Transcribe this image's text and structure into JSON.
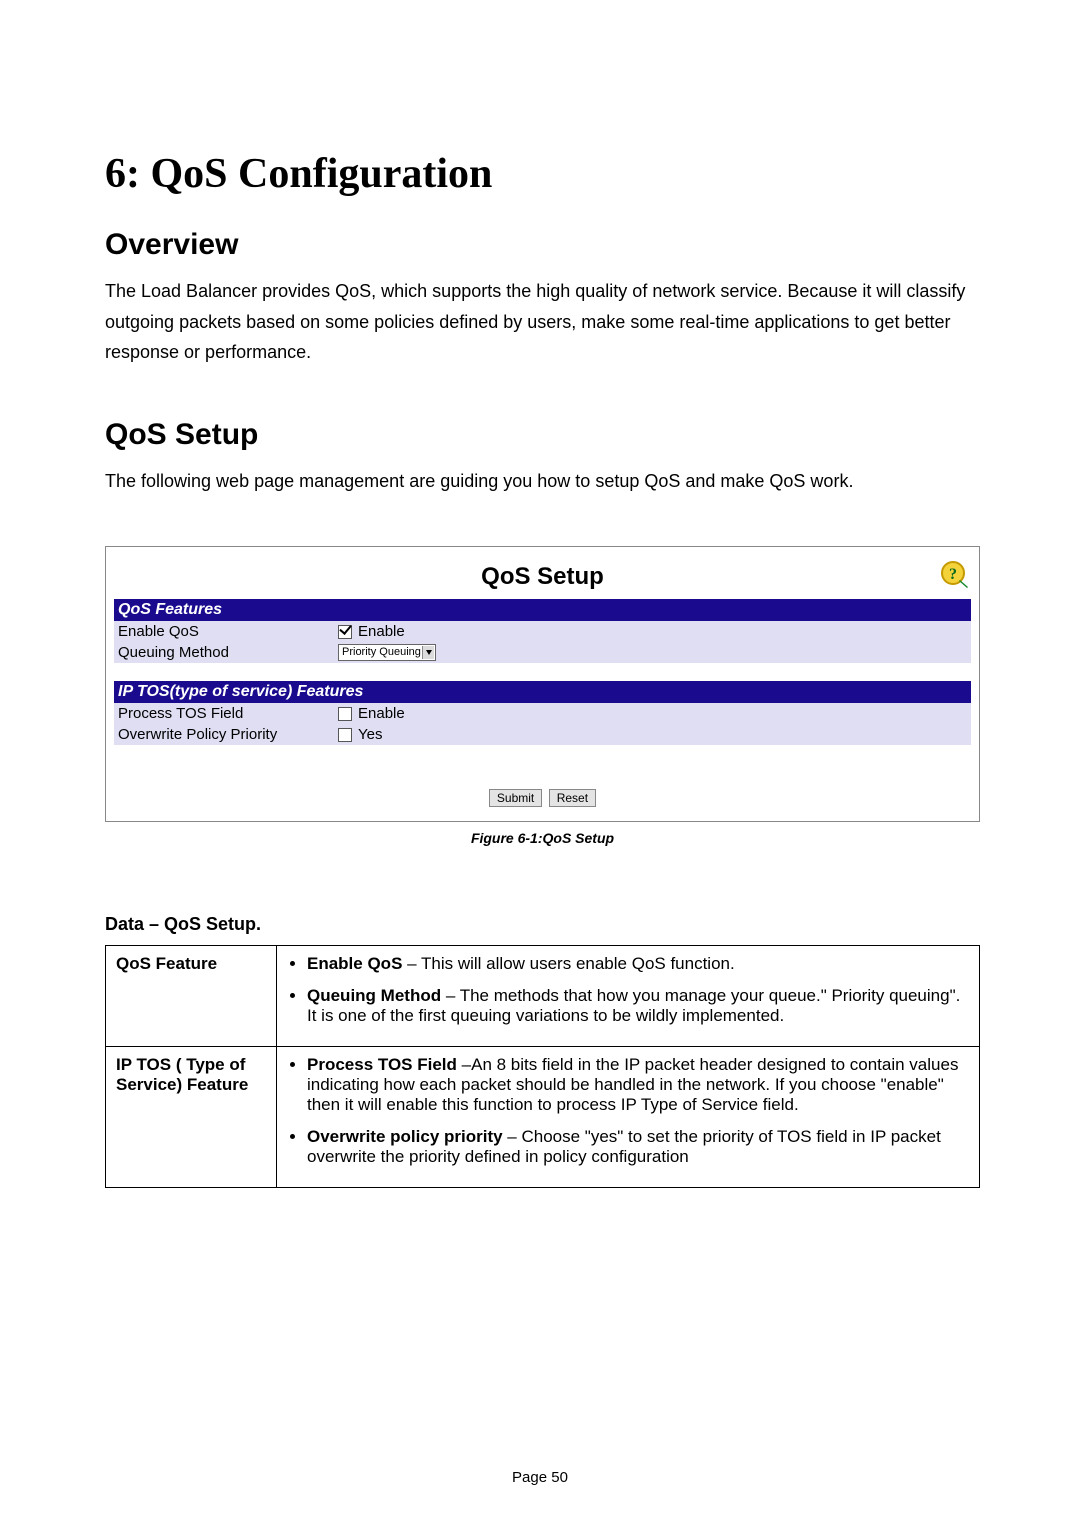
{
  "chapter_title": "6: QoS Configuration",
  "overview": {
    "heading": "Overview",
    "text": "The Load Balancer provides QoS, which supports the high quality of network service. Because it will classify outgoing packets based on some policies defined by users, make some real-time applications to get better response or performance."
  },
  "setup": {
    "heading": "QoS Setup",
    "intro": "The following web page management are guiding you how to setup QoS and make QoS work."
  },
  "screenshot": {
    "title": "QoS Setup",
    "help_tooltip": "Help",
    "section1": "QoS Features",
    "row1_label": "Enable QoS",
    "row1_value": "Enable",
    "row1_checked": true,
    "row2_label": "Queuing Method",
    "row2_value": "Priority Queuing",
    "section2": "IP TOS(type of service) Features",
    "row3_label": "Process TOS Field",
    "row3_value": "Enable",
    "row3_checked": false,
    "row4_label": "Overwrite Policy Priority",
    "row4_value": "Yes",
    "row4_checked": false,
    "submit": "Submit",
    "reset": "Reset",
    "caption": "Figure 6-1:QoS Setup"
  },
  "data_table": {
    "heading": "Data – QoS Setup.",
    "rows": [
      {
        "label": "QoS Feature",
        "items": [
          {
            "b": "Enable QoS",
            "t": " – This will allow users enable QoS function."
          },
          {
            "b": "Queuing Method",
            "t": " – The methods that how you manage your queue.\" Priority queuing\". It is one of the first queuing variations to be wildly implemented."
          }
        ]
      },
      {
        "label": "IP TOS ( Type of Service) Feature",
        "items": [
          {
            "b": "Process TOS Field",
            "t": " –An 8 bits field in the IP packet header designed to contain values indicating how each packet should be handled in the network. If you choose \"enable\" then it will enable this function to process IP Type of Service field."
          },
          {
            "b": "Overwrite policy priority",
            "t": " – Choose \"yes\" to set the priority of TOS field in IP packet overwrite the priority defined in policy configuration"
          }
        ]
      }
    ]
  },
  "page_number": "Page 50"
}
